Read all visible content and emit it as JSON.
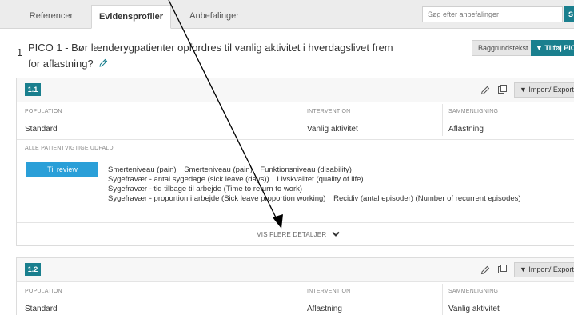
{
  "tabs": [
    {
      "label": "Referencer",
      "active": false
    },
    {
      "label": "Evidensprofiler",
      "active": true
    },
    {
      "label": "Anbefalinger",
      "active": false
    }
  ],
  "search": {
    "placeholder": "Søg efter anbefalinger"
  },
  "pico": {
    "number": "1",
    "title": "PICO 1 - Bør lænderygpatienter opfordres til vanlig aktivitet i hverdagslivet frem for aflastning?",
    "background_button": "Baggrundstekst",
    "add_button": "▼ Tilføj PICO"
  },
  "cards": [
    {
      "badge": "1.1",
      "import_button": "▼ Import/ Export",
      "population_label": "POPULATION",
      "population_value": "Standard",
      "intervention_label": "INTERVENTION",
      "intervention_value": "Vanlig aktivitet",
      "comparison_label": "SAMMENLIGNING",
      "comparison_value": "Aflastning",
      "outcomes_label": "ALLE PATIENTVIGTIGE UDFALD",
      "review_button": "Til review",
      "outcome_lines": [
        [
          "Smerteniveau (pain)",
          "Smerteniveau (pain)",
          "Funktionsniveau (disability)"
        ],
        [
          "Sygefravær - antal sygedage (sick leave (days))",
          "Livskvalitet (quality of life)"
        ],
        [
          "Sygefravær - tid tilbage til arbejde (Time to return to work)"
        ],
        [
          "Sygefravær - proportion i arbejde (Sick leave proportion working)",
          "Recidiv (antal episoder) (Number of recurrent episodes)"
        ]
      ],
      "details_link": "VIS FLERE DETALJER"
    },
    {
      "badge": "1.2",
      "import_button": "▼ Import/ Export",
      "population_label": "POPULATION",
      "population_value": "Standard",
      "intervention_label": "INTERVENTION",
      "intervention_value": "Aflastning",
      "comparison_label": "SAMMENLIGNING",
      "comparison_value": "Vanlig aktivitet"
    }
  ],
  "colors": {
    "accent": "#1a7f8e",
    "review": "#2a9fd8"
  },
  "icons": {
    "edit": "pencil-icon",
    "copy": "copy-icon",
    "expand": "chevron-down-icon"
  }
}
